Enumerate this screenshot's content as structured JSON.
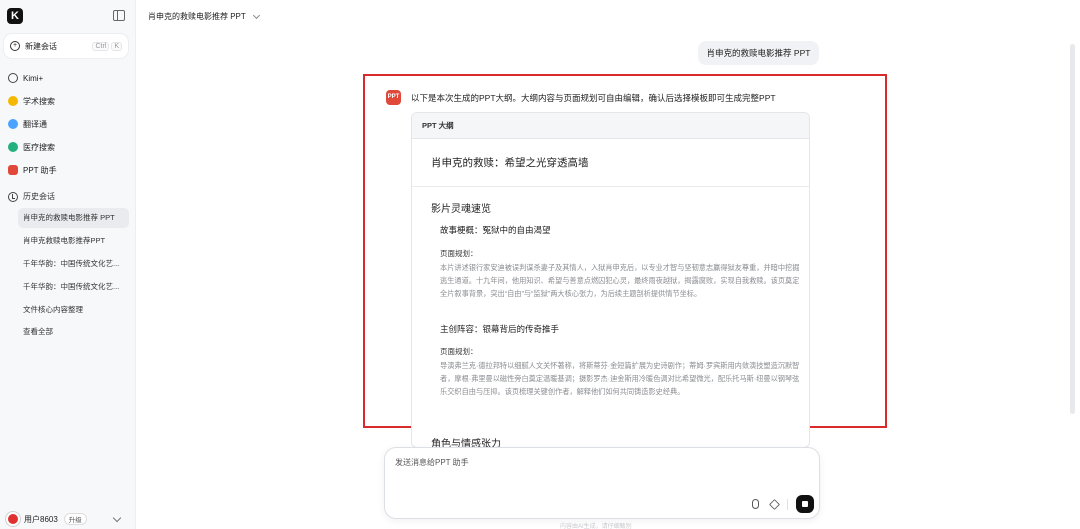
{
  "sidebar": {
    "logo": "K",
    "new_chat": {
      "label": "新建会话",
      "kbd1": "Ctrl",
      "kbd2": "K"
    },
    "nav": [
      {
        "label": "Kimi+",
        "icon": "kimi-plus-icon",
        "color": "#444444"
      },
      {
        "label": "学术搜索",
        "icon": "academic-search-icon",
        "color": "#f5b800"
      },
      {
        "label": "翻译通",
        "icon": "translate-icon",
        "color": "#4aa3ff"
      },
      {
        "label": "医疗搜索",
        "icon": "medical-search-icon",
        "color": "#22b07d"
      },
      {
        "label": "PPT 助手",
        "icon": "ppt-assistant-icon",
        "color": "#e0483a"
      }
    ],
    "history_title": "历史会话",
    "history": [
      "肖申克的救赎电影推荐 PPT",
      "肖申克救赎电影推荐PPT",
      "千年华韵：中国传统文化艺...",
      "千年华韵：中国传统文化艺...",
      "文件核心内容整理",
      "查看全部"
    ],
    "user": {
      "name": "用户8603",
      "badge": "升级"
    }
  },
  "header": {
    "title": "肖申克的救赎电影推荐 PPT"
  },
  "chat": {
    "user_message": "肖申克的救赎电影推荐 PPT",
    "bot_avatar": "PPT",
    "bot_intro": "以下是本次生成的PPT大纲。大纲内容与页面规划可自由编辑，确认后选择模板即可生成完整PPT",
    "outline": {
      "header": "PPT 大纲",
      "title": "肖申克的救赎：希望之光穿透高墙",
      "chapter1": "影片灵魂速览",
      "sub1": "故事梗概：冤狱中的自由渴望",
      "plan_label": "页面规划：",
      "plan1": "本片讲述银行家安迪被误判谋杀妻子及其情人，入狱肖申克后，以专业才智与坚韧意志赢得狱友尊重，并暗中挖掘逃生通道。十九年间，他用知识、希望与善意点燃囚犯心灵，最终雨夜越狱，揭露腐败，实现自我救赎。该页奠定全片叙事背景，突出“自由”与“监狱”两大核心张力，为后续主题剖析提供情节坐标。",
      "sub2": "主创阵容：银幕背后的传奇推手",
      "plan2": "导演弗兰克·德拉邦特以细腻人文关怀著称，将斯蒂芬·金短篇扩展为史诗剧作；蒂姆·罗宾斯用内敛演技塑造沉默智者，摩根·弗里曼以磁性旁白奠定温暖基调；摄影罗杰·迪金斯用冷暖色调对比希望微光，配乐托马斯·纽曼以钢琴弦乐交织自由与压抑。该页梳理关键创作者，解释他们如何共同铸造影史经典。",
      "chapter2": "角色与情感张力"
    },
    "input_placeholder": "发送消息给PPT 助手",
    "footer_note": "内容由AI生成，请仔细甄别"
  }
}
